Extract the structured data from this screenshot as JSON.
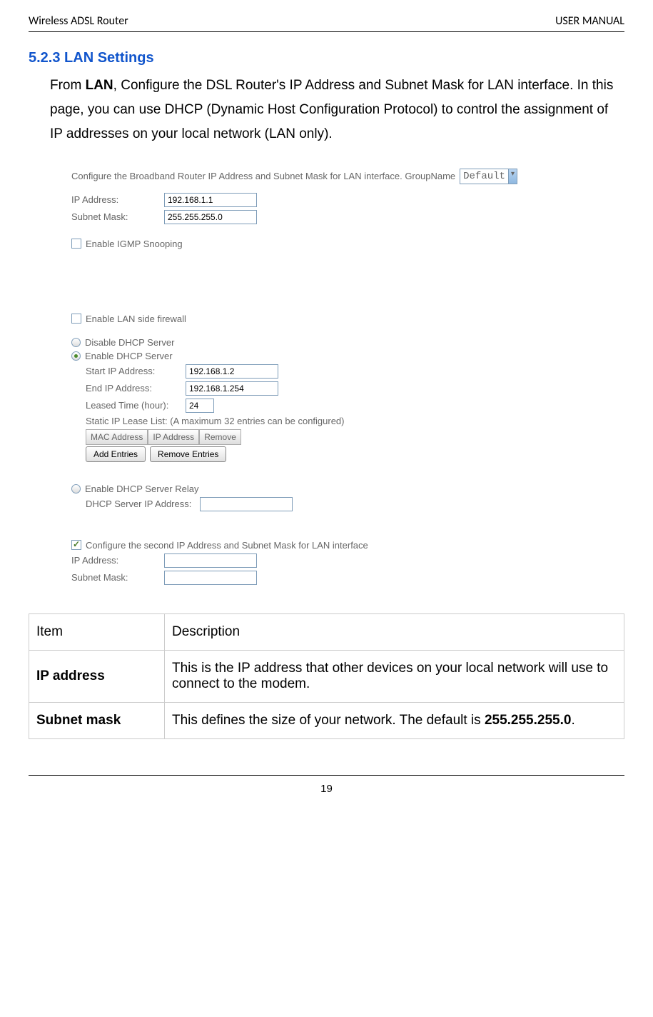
{
  "header": {
    "left": "Wireless ADSL Router",
    "right": "USER MANUAL"
  },
  "section": {
    "number": "5.2.3",
    "title": "LAN Settings",
    "body_pre": "From ",
    "body_bold": "LAN",
    "body_post": ", Configure the DSL Router's IP Address and Subnet Mask for LAN interface. In this page, you can use DHCP (Dynamic Host Configuration Protocol) to control the assignment of IP addresses on your local network (LAN only)."
  },
  "ui": {
    "config_text": "Configure the Broadband Router IP Address and Subnet Mask for LAN interface.  GroupName",
    "group_select": "Default",
    "ip_label": "IP Address:",
    "ip_value": "192.168.1.1",
    "mask_label": "Subnet Mask:",
    "mask_value": "255.255.255.0",
    "igmp": "Enable IGMP Snooping",
    "firewall": "Enable LAN side firewall",
    "disable_dhcp": "Disable DHCP Server",
    "enable_dhcp": "Enable DHCP Server",
    "start_ip_label": "Start IP Address:",
    "start_ip_value": "192.168.1.2",
    "end_ip_label": "End IP Address:",
    "end_ip_value": "192.168.1.254",
    "leased_label": "Leased Time (hour):",
    "leased_value": "24",
    "static_list": "Static IP Lease List: (A maximum 32 entries can be configured)",
    "th_mac": "MAC Address",
    "th_ip": "IP Address",
    "th_remove": "Remove",
    "add_entries": "Add Entries",
    "remove_entries": "Remove Entries",
    "relay": "Enable DHCP Server Relay",
    "relay_label": "DHCP Server IP Address:",
    "second_ip": "Configure the second IP Address and Subnet Mask for LAN interface",
    "ip2_label": "IP Address:",
    "mask2_label": "Subnet Mask:"
  },
  "table": {
    "hdr_item": "Item",
    "hdr_desc": "Description",
    "row1_item": "IP address",
    "row1_desc": "This is the IP address that other devices on your local network will use to connect to the modem.",
    "row2_item": "Subnet mask",
    "row2_desc_pre": "This defines the size of your network. The default is ",
    "row2_desc_bold": "255.255.255.0",
    "row2_desc_post": "."
  },
  "footer": {
    "page": "19"
  }
}
